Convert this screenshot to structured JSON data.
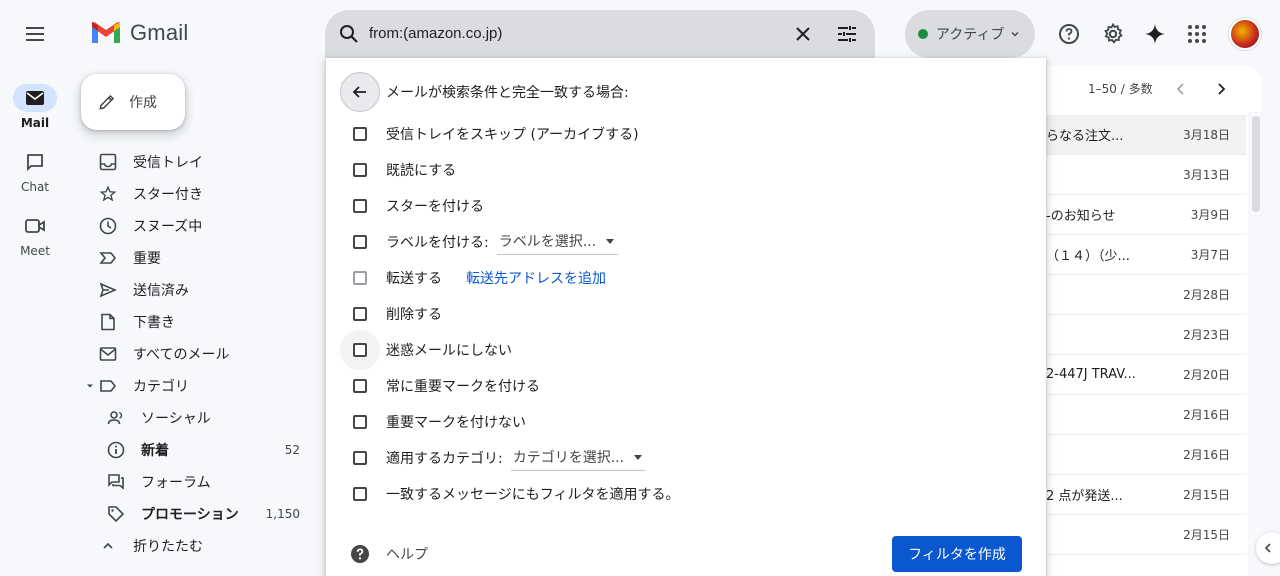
{
  "header": {
    "app_name": "Gmail",
    "search": {
      "value": "from:(amazon.co.jp)"
    },
    "status_label": "アクティブ",
    "status_color": "#1e8e3e"
  },
  "rail": [
    {
      "label": "Mail",
      "icon": "mail-icon",
      "active": true
    },
    {
      "label": "Chat",
      "icon": "chat-icon",
      "active": false
    },
    {
      "label": "Meet",
      "icon": "video-icon",
      "active": false
    }
  ],
  "compose": {
    "label": "作成"
  },
  "nav": {
    "inbox": "受信トレイ",
    "starred": "スター付き",
    "snoozed": "スヌーズ中",
    "important": "重要",
    "sent": "送信済み",
    "drafts": "下書き",
    "all_mail": "すべてのメール",
    "categories": "カテゴリ",
    "social": "ソーシャル",
    "updates": "新着",
    "updates_count": "52",
    "forums": "フォーラム",
    "promotions": "プロモーション",
    "promotions_count": "1,150",
    "collapse": "折りたたむ"
  },
  "list": {
    "pager": "1–50 / 多数",
    "rows": [
      {
        "subject": "らなる注文...",
        "date": "3月18日"
      },
      {
        "subject": "",
        "date": "3月13日"
      },
      {
        "subject": "-のお知らせ",
        "date": "3月9日"
      },
      {
        "subject": "（１４）（少...",
        "date": "3月7日"
      },
      {
        "subject": "",
        "date": "2月28日"
      },
      {
        "subject": "",
        "date": "2月23日"
      },
      {
        "subject": "2-447J TRAV...",
        "date": "2月20日"
      },
      {
        "subject": "",
        "date": "2月16日"
      },
      {
        "subject": "",
        "date": "2月16日"
      },
      {
        "subject": "2 点が発送...",
        "date": "2月15日"
      },
      {
        "subject": "",
        "date": "2月15日"
      }
    ]
  },
  "filter": {
    "heading": "メールが検索条件と完全一致する場合:",
    "skip_inbox": "受信トレイをスキップ (アーカイブする)",
    "mark_read": "既読にする",
    "star": "スターを付ける",
    "apply_label": "ラベルを付ける:",
    "label_select": "ラベルを選択...",
    "forward": "転送する",
    "forward_link": "転送先アドレスを追加",
    "delete": "削除する",
    "never_spam": "迷惑メールにしない",
    "always_important": "常に重要マークを付ける",
    "never_important": "重要マークを付けない",
    "categorize": "適用するカテゴリ:",
    "category_select": "カテゴリを選択...",
    "also_apply": "一致するメッセージにもフィルタを適用する。",
    "help": "ヘルプ",
    "create_button": "フィルタを作成"
  }
}
